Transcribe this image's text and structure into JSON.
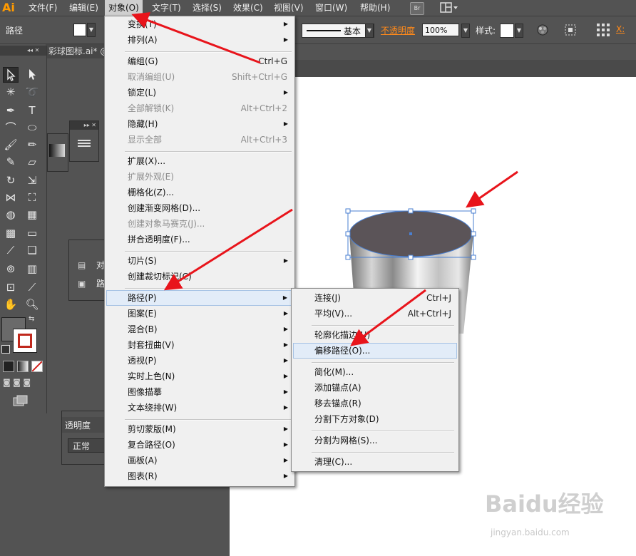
{
  "app": {
    "logo": "Ai",
    "bridge_badge": "Br"
  },
  "menubar": {
    "items": [
      {
        "label": "文件(F)"
      },
      {
        "label": "编辑(E)"
      },
      {
        "label": "对象(O)"
      },
      {
        "label": "文字(T)"
      },
      {
        "label": "选择(S)"
      },
      {
        "label": "效果(C)"
      },
      {
        "label": "视图(V)"
      },
      {
        "label": "窗口(W)"
      },
      {
        "label": "帮助(H)"
      }
    ],
    "active": "对象(O)"
  },
  "controlbar": {
    "selection_type": "路径",
    "stroke_profile": "基本",
    "opacity_label": "不透明度",
    "opacity_value": "100%",
    "style_label": "样式:",
    "x_label": "X:"
  },
  "document": {
    "tab_title": "彩球图标.ai* @"
  },
  "panels": {
    "align_items": [
      "对",
      "路"
    ],
    "transparency_title": "透明度",
    "blend_mode": "正常"
  },
  "object_menu": {
    "items": [
      {
        "label": "变换(T)",
        "submenu": true
      },
      {
        "label": "排列(A)",
        "submenu": true
      },
      {
        "label": "编组(G)",
        "shortcut": "Ctrl+G"
      },
      {
        "label": "取消编组(U)",
        "shortcut": "Shift+Ctrl+G",
        "disabled": true
      },
      {
        "label": "锁定(L)",
        "submenu": true
      },
      {
        "label": "全部解锁(K)",
        "shortcut": "Alt+Ctrl+2",
        "disabled": true
      },
      {
        "label": "隐藏(H)",
        "submenu": true
      },
      {
        "label": "显示全部",
        "shortcut": "Alt+Ctrl+3",
        "disabled": true
      },
      {
        "label": "扩展(X)..."
      },
      {
        "label": "扩展外观(E)",
        "disabled": true
      },
      {
        "label": "栅格化(Z)..."
      },
      {
        "label": "创建渐变网格(D)..."
      },
      {
        "label": "创建对象马赛克(J)...",
        "disabled": true
      },
      {
        "label": "拼合透明度(F)..."
      },
      {
        "label": "切片(S)",
        "submenu": true
      },
      {
        "label": "创建裁切标记(C)"
      },
      {
        "label": "路径(P)",
        "submenu": true,
        "highlighted": true
      },
      {
        "label": "图案(E)",
        "submenu": true
      },
      {
        "label": "混合(B)",
        "submenu": true
      },
      {
        "label": "封套扭曲(V)",
        "submenu": true
      },
      {
        "label": "透视(P)",
        "submenu": true
      },
      {
        "label": "实时上色(N)",
        "submenu": true
      },
      {
        "label": "图像描摹",
        "submenu": true
      },
      {
        "label": "文本绕排(W)",
        "submenu": true
      },
      {
        "label": "剪切蒙版(M)",
        "submenu": true
      },
      {
        "label": "复合路径(O)",
        "submenu": true
      },
      {
        "label": "画板(A)",
        "submenu": true
      },
      {
        "label": "图表(R)",
        "submenu": true
      }
    ]
  },
  "path_submenu": {
    "items": [
      {
        "label": "连接(J)",
        "shortcut": "Ctrl+J"
      },
      {
        "label": "平均(V)...",
        "shortcut": "Alt+Ctrl+J"
      },
      {
        "label": "轮廓化描边(U)"
      },
      {
        "label": "偏移路径(O)...",
        "highlighted": true
      },
      {
        "label": "简化(M)..."
      },
      {
        "label": "添加锚点(A)"
      },
      {
        "label": "移去锚点(R)"
      },
      {
        "label": "分割下方对象(D)"
      },
      {
        "label": "分割为网格(S)..."
      },
      {
        "label": "清理(C)..."
      }
    ]
  },
  "colors": {
    "annotation_arrow": "#e8141b",
    "selection_blue": "#4a7fd0",
    "cylinder_top": "#5b5458",
    "ui_dark": "#535353"
  },
  "watermark": {
    "brand": "Baidu经验",
    "url": "jingyan.baidu.com"
  }
}
